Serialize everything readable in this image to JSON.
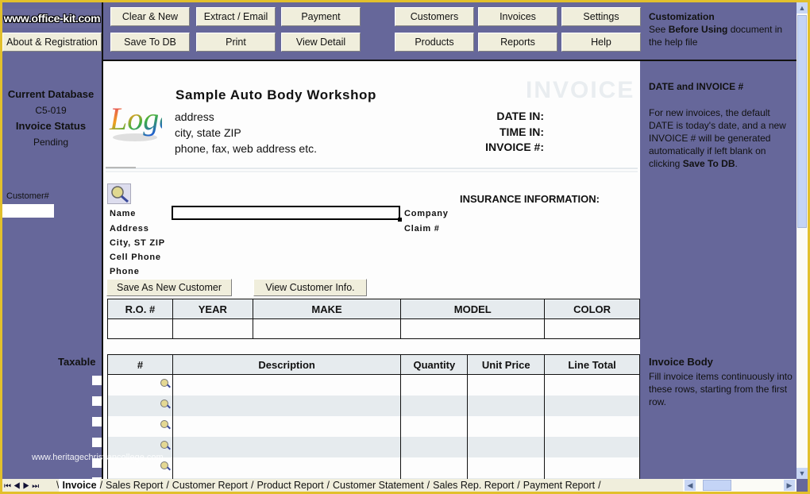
{
  "brand": "www.office-kit.com",
  "toolbar": {
    "about": "About & Registration",
    "clear_new": "Clear & New",
    "extract_email": "Extract / Email",
    "payment": "Payment",
    "save_to_db": "Save To DB",
    "print": "Print",
    "view_detail": "View Detail",
    "customers": "Customers",
    "invoices": "Invoices",
    "settings": "Settings",
    "products": "Products",
    "reports": "Reports",
    "help": "Help"
  },
  "customization": {
    "title": "Customization",
    "text_pre": "See ",
    "text_bold": "Before Using",
    "text_post": " document in the help file"
  },
  "left_panel": {
    "current_db_label": "Current Database",
    "current_db_value": "C5-019",
    "status_label": "Invoice Status",
    "status_value": "Pending",
    "customer_no_label": "Customer#",
    "customer_no_value": "",
    "taxable_label": "Taxable"
  },
  "company": {
    "logo_text": "Logo",
    "name": "Sample Auto Body Workshop",
    "address": "address",
    "city": "city, state ZIP",
    "contact": "phone, fax, web address etc."
  },
  "invoice_header": {
    "watermark": "INVOICE",
    "date_in": "DATE IN:",
    "time_in": "TIME IN:",
    "invoice_no": "INVOICE #:"
  },
  "right_panel": {
    "date_title": "DATE and INVOICE #",
    "date_text_pre": "For new invoices, the default DATE is today's date, and a new INVOICE # will be generated automatically if left blank  on clicking ",
    "date_text_bold": "Save To DB",
    "date_text_post": ".",
    "body_title": "Invoice Body",
    "body_text": "Fill invoice items continuously into these rows, starting from the first row."
  },
  "customer": {
    "name_label": "Name",
    "address_label": "Address",
    "city_label": "City, ST ZIP",
    "cell_label": "Cell Phone",
    "phone_label": "Phone",
    "name_value": "",
    "save_new_btn": "Save As New Customer",
    "view_info_btn": "View Customer Info."
  },
  "insurance": {
    "title": "INSURANCE INFORMATION:",
    "company_label": "Company",
    "claim_label": "Claim #"
  },
  "vehicle_table": {
    "headers": [
      "R.O. #",
      "YEAR",
      "MAKE",
      "MODEL",
      "COLOR"
    ],
    "rows": [
      [
        "",
        "",
        "",
        "",
        ""
      ]
    ]
  },
  "items_table": {
    "headers": [
      "#",
      "Description",
      "Quantity",
      "Unit Price",
      "Line Total"
    ],
    "rows": [
      [
        "",
        "",
        "",
        "",
        ""
      ],
      [
        "",
        "",
        "",
        "",
        ""
      ],
      [
        "",
        "",
        "",
        "",
        ""
      ],
      [
        "",
        "",
        "",
        "",
        ""
      ],
      [
        "",
        "",
        "",
        "",
        ""
      ],
      [
        "",
        "",
        "",
        "",
        ""
      ]
    ]
  },
  "watermark_url": "www.heritagechristiancollege.com",
  "sheet_tabs": [
    "Invoice",
    "Sales Report",
    "Customer Report",
    "Product Report",
    "Customer Statement",
    "Sales Rep. Report",
    "Payment Report"
  ],
  "active_tab": "Invoice"
}
